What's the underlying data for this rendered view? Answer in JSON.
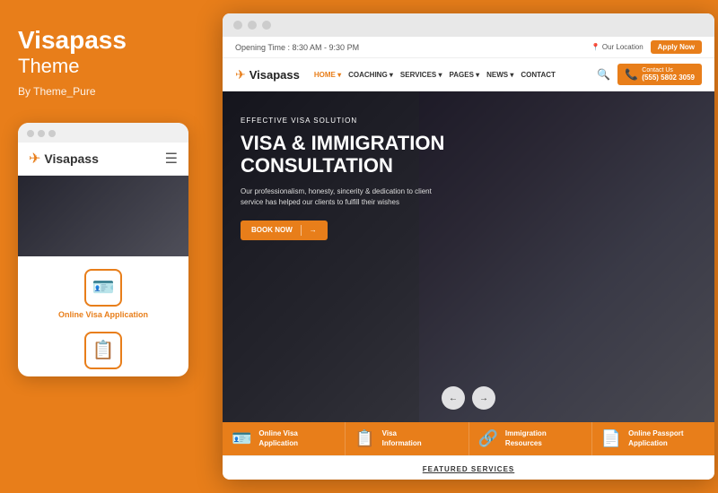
{
  "left": {
    "brand_title": "Visapass",
    "brand_subtitle": "Theme",
    "brand_author": "By Theme_Pure",
    "mobile_logo_text": "Visapass",
    "online_visa_label": "Online Visa Application",
    "dots": [
      "dot1",
      "dot2",
      "dot3"
    ]
  },
  "browser": {
    "topbar": {
      "opening_time": "Opening Time : 8:30 AM - 9:30 PM",
      "location": "Our Location",
      "apply_label": "Apply Now"
    },
    "nav": {
      "logo_text": "Visapass",
      "links": [
        {
          "label": "HOME",
          "has_dropdown": true
        },
        {
          "label": "COACHING",
          "has_dropdown": true
        },
        {
          "label": "SERVICES",
          "has_dropdown": true
        },
        {
          "label": "PAGES",
          "has_dropdown": true
        },
        {
          "label": "NEWS",
          "has_dropdown": true
        },
        {
          "label": "CONTACT",
          "has_dropdown": false
        }
      ],
      "contact_label": "Contact Us",
      "phone": "(555) 5802 3059"
    },
    "hero": {
      "eyebrow": "EFFECTIVE VISA SOLUTION",
      "title": "VISA & IMMIGRATION CONSULTATION",
      "desc": "Our professionalism, honesty, sincerity & dedication to client service has helped our clients to fulfill their wishes",
      "book_btn": "BOOK NOW",
      "arrow_left": "←",
      "arrow_right": "→"
    },
    "features": [
      {
        "icon": "🪪",
        "label": "Online Visa\nApplication"
      },
      {
        "icon": "📋",
        "label": "Visa\nInformation"
      },
      {
        "icon": "🔗",
        "label": "Immigration\nResources"
      },
      {
        "icon": "📄",
        "label": "Online Passport\nApplication"
      }
    ],
    "featured_services": "FEATURED SERVICES"
  }
}
